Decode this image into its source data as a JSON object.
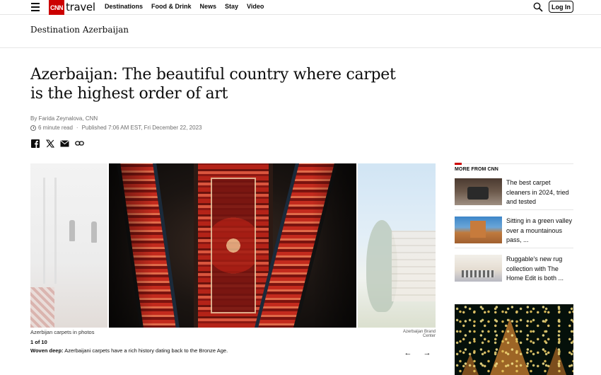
{
  "header": {
    "brand_mark": "CNN",
    "brand_name": "travel",
    "nav": [
      "Destinations",
      "Food & Drink",
      "News",
      "Stay",
      "Video"
    ],
    "login_label": "Log In",
    "accent_color": "#cc0000"
  },
  "section": {
    "title": "Destination Azerbaijan"
  },
  "article": {
    "headline": "Azerbaijan: The beautiful country where carpet is the highest order of art",
    "byline": "By Farida Zeynalova, CNN",
    "read_time": "6 minute read",
    "separator": "·",
    "published": "Published 7:06 AM EST, Fri December 22, 2023",
    "share_icons": [
      "facebook-icon",
      "x-icon",
      "email-icon",
      "link-icon"
    ]
  },
  "gallery": {
    "caption_title": "Azerbijan carpets in photos",
    "credit": "Azerbaijan Brand Center",
    "counter": "1 of 10",
    "desc_bold": "Woven deep:",
    "desc_text": " Azerbaijani carpets have a rich history dating back to the Bronze Age.",
    "prev_glyph": "←",
    "next_glyph": "→"
  },
  "sidebar": {
    "title": "MORE FROM CNN",
    "items": [
      {
        "text": "The best carpet cleaners in 2024, tried and tested"
      },
      {
        "text": "Sitting in a green valley over a mountainous pass, ..."
      },
      {
        "text": "Ruggable's new rug collection with The Home Edit is both ..."
      }
    ]
  }
}
